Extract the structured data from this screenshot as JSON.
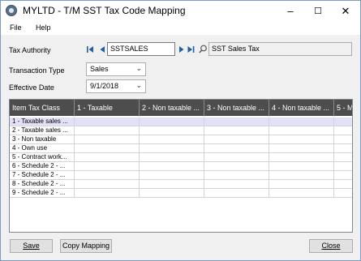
{
  "window": {
    "title": "MYLTD - T/M SST Tax Code Mapping"
  },
  "title_buttons": {
    "minimize": "–",
    "maximize": "☐",
    "close": "✕"
  },
  "menu": {
    "file": "File",
    "help": "Help"
  },
  "fields": {
    "tax_authority": {
      "label": "Tax Authority",
      "value": "SSTSALES",
      "description": "SST Sales Tax"
    },
    "transaction_type": {
      "label": "Transaction Type",
      "value": "Sales"
    },
    "effective_date": {
      "label": "Effective Date",
      "value": "9/1/2018"
    }
  },
  "grid": {
    "headers": [
      "Item Tax Class",
      "1 - Taxable",
      "2 - Non taxable ...",
      "3 - Non taxable ...",
      "4 - Non taxable ...",
      "5 - M"
    ],
    "rows": [
      "1 - Taxable sales ...",
      "2 - Taxable sales ...",
      "3 - Non taxable",
      "4 - Own use",
      "5 - Contract work...",
      "6 - Schedule 2 - ...",
      "7 - Schedule 2 - ...",
      "8 - Schedule 2 - ...",
      "9 - Schedule 2 - ..."
    ],
    "selected_row": 0
  },
  "buttons": {
    "save": "Save",
    "copy_mapping": "Copy Mapping",
    "close": "Close"
  },
  "colors": {
    "grid_header": "#4d4d4d",
    "selected_row": "#e3e1f7",
    "nav_arrow": "#1f5ea8"
  }
}
